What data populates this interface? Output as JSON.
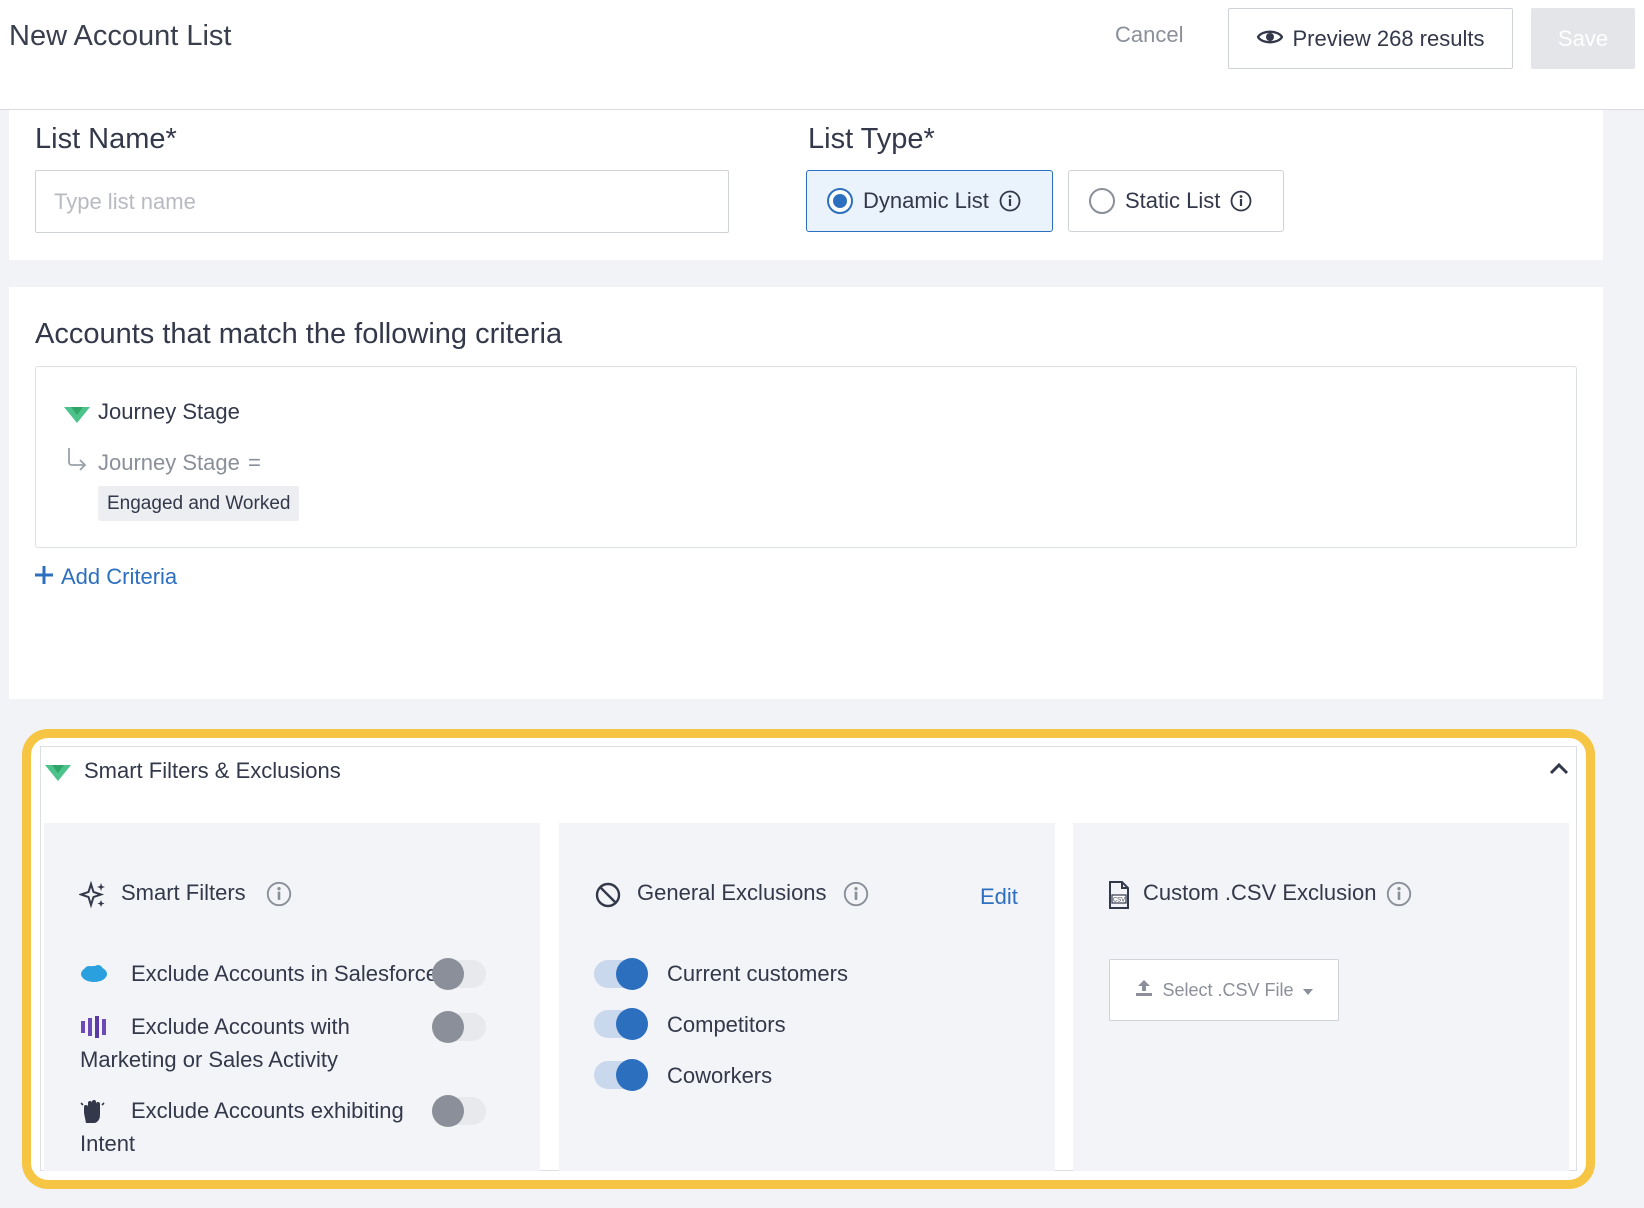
{
  "header": {
    "title": "New Account List",
    "cancel_label": "Cancel",
    "preview_label": "Preview 268 results",
    "save_label": "Save"
  },
  "list_name": {
    "label": "List Name*",
    "placeholder": "Type list name",
    "value": ""
  },
  "list_type": {
    "label": "List Type*",
    "options": [
      {
        "label": "Dynamic List",
        "selected": true
      },
      {
        "label": "Static List",
        "selected": false
      }
    ]
  },
  "criteria": {
    "heading": "Accounts that match the following criteria",
    "group_title": "Journey Stage",
    "condition_field": "Journey Stage",
    "condition_operator": "=",
    "condition_value": "Engaged and Worked",
    "add_label": "Add Criteria"
  },
  "smart_section": {
    "title": "Smart Filters & Exclusions",
    "smart_filters": {
      "title": "Smart Filters",
      "items": [
        {
          "label": "Exclude Accounts in Salesforce",
          "enabled": false
        },
        {
          "label": "Exclude Accounts with Marketing or Sales Activity",
          "enabled": false
        },
        {
          "label": "Exclude Accounts exhibiting Intent",
          "enabled": false
        }
      ]
    },
    "general_exclusions": {
      "title": "General Exclusions",
      "edit_label": "Edit",
      "items": [
        {
          "label": "Current customers",
          "enabled": true
        },
        {
          "label": "Competitors",
          "enabled": true
        },
        {
          "label": "Coworkers",
          "enabled": true
        }
      ]
    },
    "csv_exclusion": {
      "title": "Custom .CSV Exclusion",
      "button_label": "Select .CSV File"
    }
  },
  "colors": {
    "accent": "#2d6fbf",
    "highlight_border": "#f6c544",
    "brand_green": "#4cc38a"
  }
}
